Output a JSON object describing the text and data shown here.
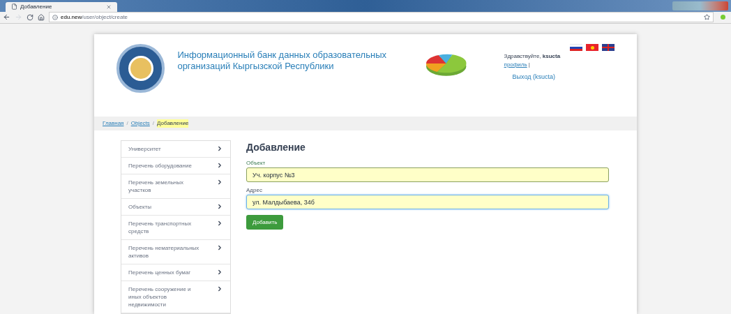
{
  "browser": {
    "tab_title": "Добавление",
    "url_host": "edu.new",
    "url_path": "/user/object/create"
  },
  "header": {
    "title": "Информационный банк данных образовательных организаций Кыргызской Республики",
    "greeting": "Здравствуйте, ",
    "user": "ksucta",
    "profile_link": "профиль",
    "separator": "|",
    "logout": "Выход (ksucta)"
  },
  "breadcrumb_separator": "/",
  "breadcrumbs": [
    {
      "label": "Главная",
      "selected": false
    },
    {
      "label": "Objects",
      "selected": false
    },
    {
      "label": "Добавление",
      "selected": true
    }
  ],
  "sidebar": {
    "items": [
      {
        "label": "Университет"
      },
      {
        "label": "Перечень оборудование"
      },
      {
        "label": "Перечень земельных участков"
      },
      {
        "label": "Объекты"
      },
      {
        "label": "Перечень транспортных средств"
      },
      {
        "label": "Перечень нематериальных активов"
      },
      {
        "label": "Перечень ценных бумаг"
      },
      {
        "label": "Перечень сооружение и иных объектов недвижимости"
      }
    ]
  },
  "form": {
    "heading": "Добавление",
    "fields": [
      {
        "label": "Объект",
        "value": "Уч. корпус №3",
        "focused": false
      },
      {
        "label": "Адрес",
        "value": "ул. Малдыбаева, 34б",
        "focused": true
      }
    ],
    "submit": "Добавить"
  }
}
